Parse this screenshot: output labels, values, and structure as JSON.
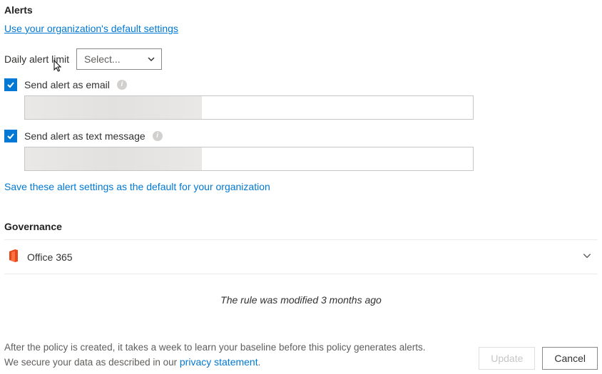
{
  "alerts": {
    "heading": "Alerts",
    "default_link": "Use your organization's default settings",
    "daily_label": "Daily alert limit",
    "daily_select_placeholder": "Select...",
    "email_checked": true,
    "email_label": "Send alert as email",
    "email_value_redacted": true,
    "sms_checked": true,
    "sms_label": "Send alert as text message",
    "sms_value_redacted": true,
    "save_default_link": "Save these alert settings as the default for your organization"
  },
  "governance": {
    "heading": "Governance",
    "items": [
      {
        "name": "Office 365",
        "icon": "office-365-icon"
      }
    ]
  },
  "modified_note": "The rule was modified 3 months ago",
  "footer": {
    "line1": "After the policy is created, it takes a week to learn your baseline before this policy generates alerts.",
    "line2_pre": "We secure your data as described in our ",
    "privacy_link": "privacy statement",
    "line2_post": ".",
    "update_label": "Update",
    "cancel_label": "Cancel"
  }
}
